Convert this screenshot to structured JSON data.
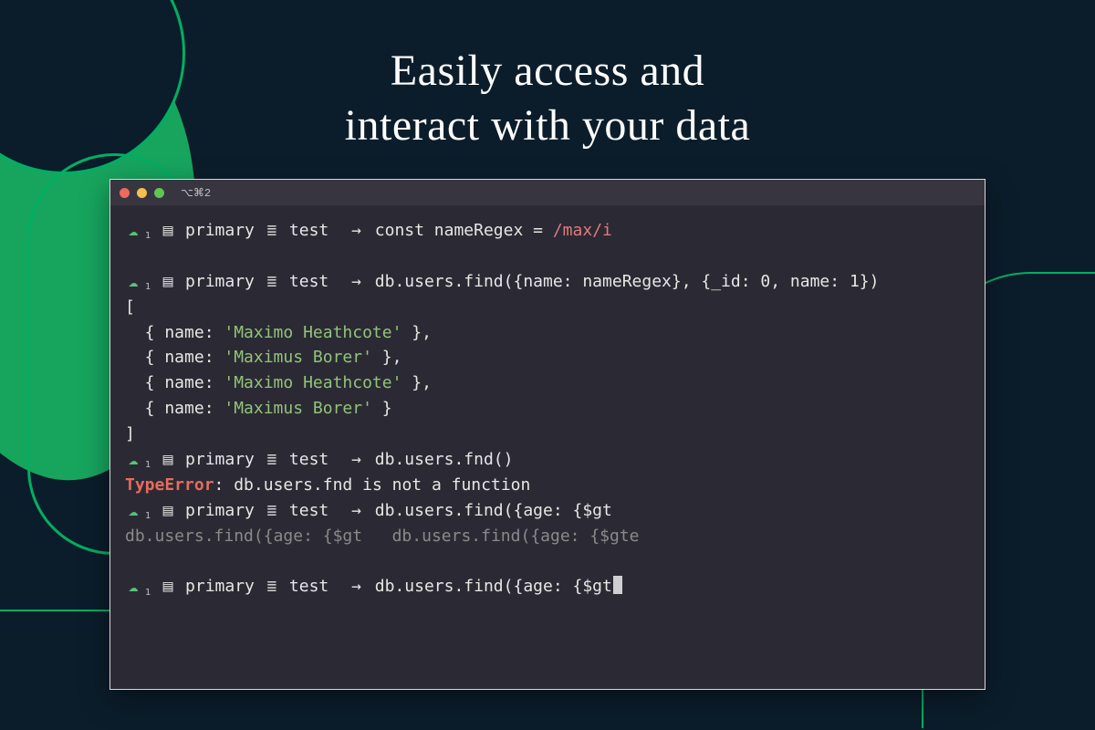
{
  "headline": {
    "line1": "Easily access and",
    "line2": "interact with your data"
  },
  "colors": {
    "bg": "#0b1d2b",
    "accent": "#00af62",
    "term_bg": "#2b2a34",
    "string": "#92c379",
    "regex": "#e07b7b",
    "error": "#e86c5d"
  },
  "terminal": {
    "title": "⌥⌘2",
    "icons": {
      "cloud": "☁",
      "cloud_sub": "1",
      "book": "▤",
      "db": "≣",
      "arrow": "→"
    },
    "prompt": {
      "label_primary": "primary",
      "label_db": "test"
    },
    "lines": [
      {
        "type": "prompt",
        "cmd_pre": "const nameRegex = ",
        "cmd_regex": "/max/i"
      },
      {
        "type": "blank"
      },
      {
        "type": "prompt",
        "cmd": "db.users.find({name: nameRegex}, {_id: 0, name: 1})"
      },
      {
        "type": "text",
        "text": "["
      },
      {
        "type": "result",
        "pre": "  { name: ",
        "str": "'Maximo Heathcote'",
        "post": " },"
      },
      {
        "type": "result",
        "pre": "  { name: ",
        "str": "'Maximus Borer'",
        "post": " },"
      },
      {
        "type": "result",
        "pre": "  { name: ",
        "str": "'Maximo Heathcote'",
        "post": " },"
      },
      {
        "type": "result",
        "pre": "  { name: ",
        "str": "'Maximus Borer'",
        "post": " }"
      },
      {
        "type": "text",
        "text": "]"
      },
      {
        "type": "prompt",
        "cmd": "db.users.fnd()"
      },
      {
        "type": "error",
        "err": "TypeError",
        "rest": ": db.users.fnd is not a function"
      },
      {
        "type": "prompt",
        "cmd": "db.users.find({age: {$gt"
      },
      {
        "type": "ghost",
        "text": "db.users.find({age: {$gt   db.users.find({age: {$gte"
      },
      {
        "type": "blank"
      },
      {
        "type": "prompt",
        "cmd": "db.users.find({age: {$gt",
        "cursor": true
      }
    ]
  }
}
